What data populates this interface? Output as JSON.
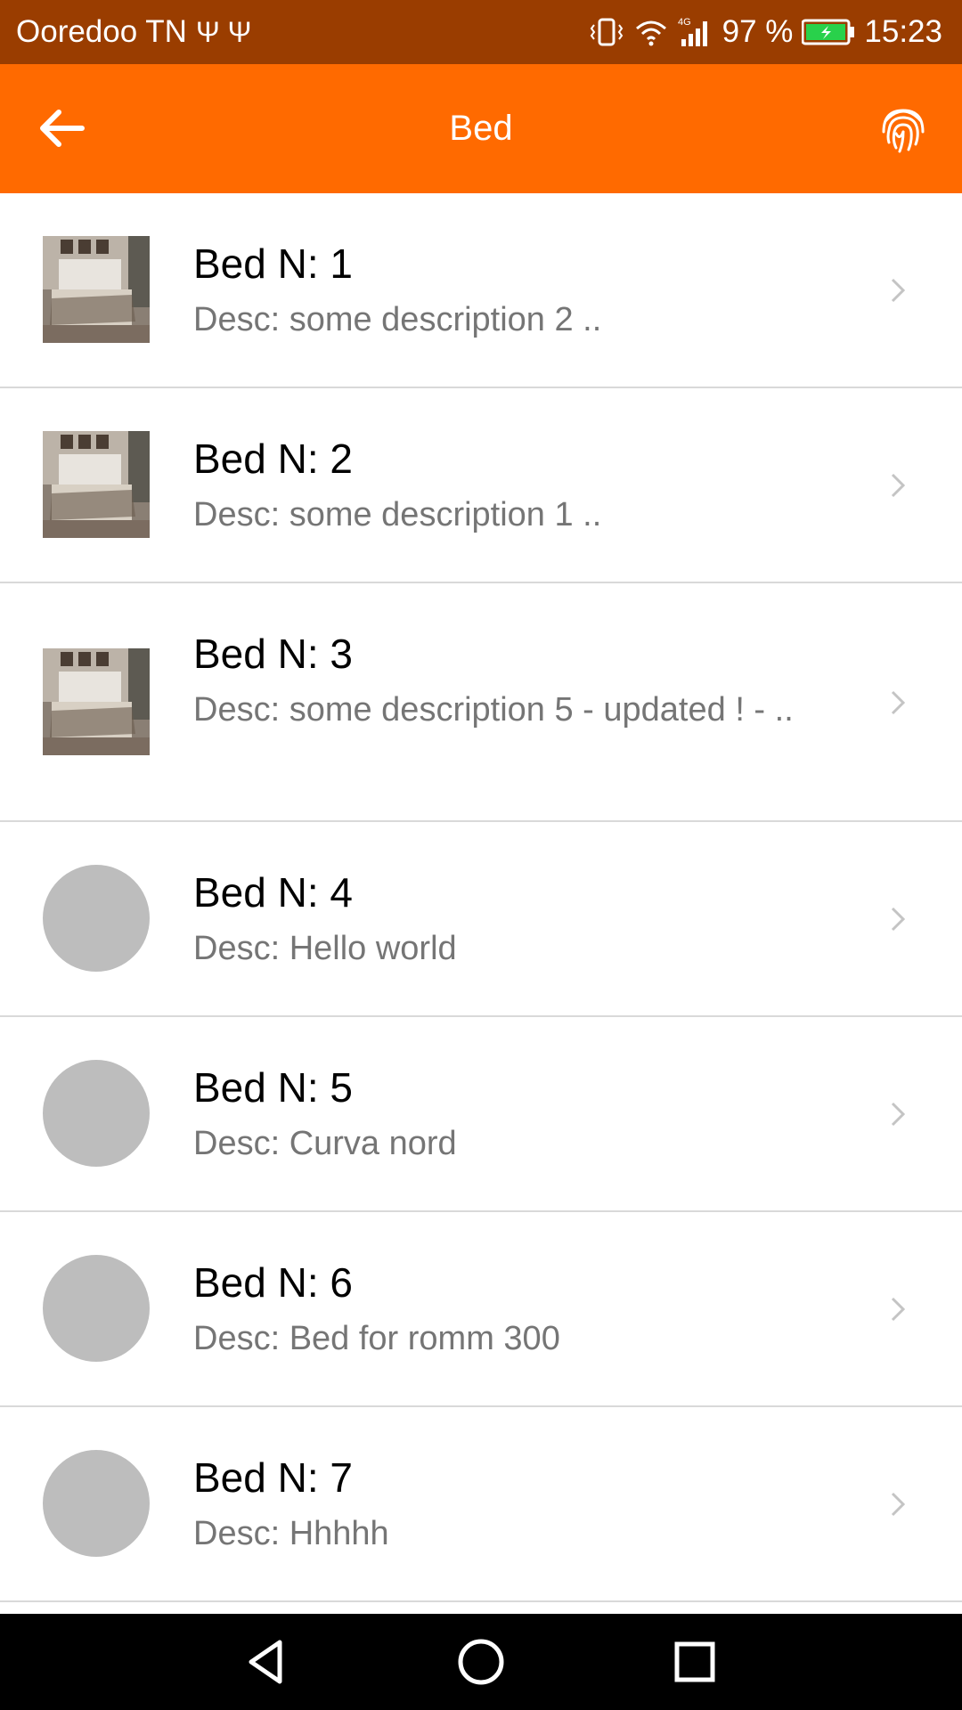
{
  "status_bar": {
    "carrier": "Ooredoo TN",
    "usb_glyph": "Ψ Ψ",
    "battery_percent": "97 %",
    "time": "15:23",
    "icons": [
      "usb-icon",
      "vibrate-icon",
      "wifi-icon",
      "signal-4g-icon",
      "battery-charging-icon"
    ]
  },
  "app_bar": {
    "title": "Bed",
    "left_icon": "back-arrow-icon",
    "right_icon": "fingerprint-icon"
  },
  "items": [
    {
      "title": "Bed N: 1",
      "desc": "Desc: some description 2 ..",
      "media": "bed-photo"
    },
    {
      "title": "Bed N: 2",
      "desc": "Desc: some description 1 ..",
      "media": "bed-photo"
    },
    {
      "title": "Bed N: 3",
      "desc": "Desc: some description 5 - updated ! - ..",
      "media": "bed-photo"
    },
    {
      "title": "Bed N: 4",
      "desc": "Desc: Hello world",
      "media": "placeholder-circle"
    },
    {
      "title": "Bed N: 5",
      "desc": "Desc: Curva nord",
      "media": "placeholder-circle"
    },
    {
      "title": "Bed N: 6",
      "desc": "Desc: Bed for romm 300",
      "media": "placeholder-circle"
    },
    {
      "title": "Bed N: 7",
      "desc": "Desc: Hhhhh",
      "media": "placeholder-circle"
    }
  ],
  "colors": {
    "status_bar": "#9a3d00",
    "app_bar": "#ff6a00",
    "divider": "#d9d9d9",
    "placeholder": "#bdbdbd",
    "desc_text": "#757575",
    "nav_bar": "#000000"
  },
  "nav_bar": {
    "buttons": [
      "back-triangle-icon",
      "home-circle-icon",
      "recents-square-icon"
    ]
  }
}
